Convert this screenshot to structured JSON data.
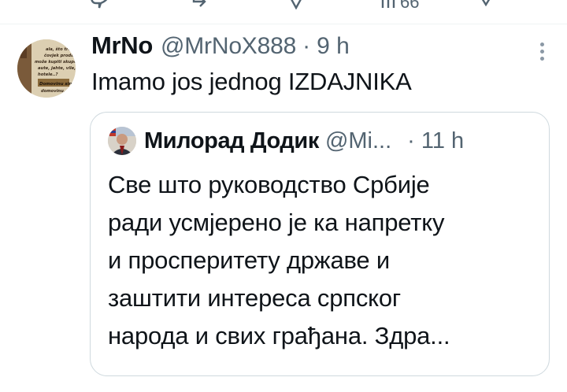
{
  "tweet": {
    "display_name": "MrNo",
    "handle": "@MrNoX888",
    "separator": "·",
    "time": "9 h",
    "text": "Imamo jos jednog IZDAJNIKA",
    "avatar_lines": [
      "ala, što treba",
      "čovjek proda, d.",
      "može kupiti skupe",
      "aute, jahte, vile,",
      "hotele..?",
      "Domovinu sine",
      "domovinu..."
    ]
  },
  "quote": {
    "display_name": "Милорад Додик",
    "handle": "@Mi...",
    "separator": "·",
    "time": "11 h",
    "lines": [
      "Све што руководство Србије",
      "ради усмјерено је ка напретку",
      "и просперитету државе и",
      "заштити интереса српског",
      "народа и свих грађана. Здра..."
    ]
  },
  "top_actions": {
    "views_count": "66"
  },
  "colors": {
    "text_primary": "#0f1419",
    "text_secondary": "#536471",
    "border": "#cfd9de"
  }
}
